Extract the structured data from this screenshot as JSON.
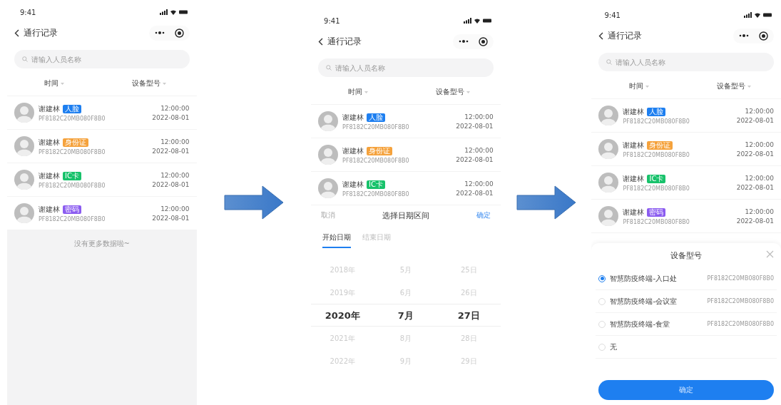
{
  "screens": [
    {
      "status_time": "9:41",
      "title": "通行记录",
      "search": {
        "placeholder": "请输入人员名称"
      },
      "filters": [
        "时间",
        "设备型号"
      ],
      "records": [
        {
          "name": "谢建林",
          "tag": {
            "label": "人脸",
            "color": "#1e7ff0"
          },
          "device": "PF8182C20MB080F8B0",
          "time": "12:00:00",
          "date": "2022-08-01"
        },
        {
          "name": "谢建林",
          "tag": {
            "label": "身份证",
            "color": "#f5a23c"
          },
          "device": "PF8182C20MB080F8B0",
          "time": "12:00:00",
          "date": "2022-08-01"
        },
        {
          "name": "谢建林",
          "tag": {
            "label": "IC卡",
            "color": "#18c26b"
          },
          "device": "PF8182C20MB080F8B0",
          "time": "12:00:00",
          "date": "2022-08-01"
        },
        {
          "name": "谢建林",
          "tag": {
            "label": "密码",
            "color": "#8b5cf0"
          },
          "device": "PF8182C20MB080F8B0",
          "time": "12:00:00",
          "date": "2022-08-01"
        }
      ],
      "footer": "没有更多数据啦~"
    },
    {
      "status_time": "9:41",
      "title": "通行记录",
      "search": {
        "placeholder": "请输入人员名称"
      },
      "filters": [
        "时间",
        "设备型号"
      ],
      "records": [
        {
          "name": "谢建林",
          "tag": {
            "label": "人脸",
            "color": "#1e7ff0"
          },
          "device": "PF8182C20MB080F8B0",
          "time": "12:00:00",
          "date": "2022-08-01"
        },
        {
          "name": "谢建林",
          "tag": {
            "label": "身份证",
            "color": "#f5a23c"
          },
          "device": "PF8182C20MB080F8B0",
          "time": "12:00:00",
          "date": "2022-08-01"
        },
        {
          "name": "谢建林",
          "tag": {
            "label": "IC卡",
            "color": "#18c26b"
          },
          "device": "PF8182C20MB080F8B0",
          "time": "12:00:00",
          "date": "2022-08-01"
        }
      ],
      "date_picker": {
        "cancel": "取消",
        "title": "选择日期区间",
        "confirm": "确定",
        "tabs": [
          {
            "label": "开始日期",
            "selected": true
          },
          {
            "label": "结束日期",
            "selected": false
          }
        ],
        "columns": [
          [
            {
              "label": "2018年",
              "selected": false
            },
            {
              "label": "2019年",
              "selected": false
            },
            {
              "label": "2020年",
              "selected": true
            },
            {
              "label": "2021年",
              "selected": false
            },
            {
              "label": "2022年",
              "selected": false
            }
          ],
          [
            {
              "label": "5月",
              "selected": false
            },
            {
              "label": "6月",
              "selected": false
            },
            {
              "label": "7月",
              "selected": true
            },
            {
              "label": "8月",
              "selected": false
            },
            {
              "label": "9月",
              "selected": false
            }
          ],
          [
            {
              "label": "25日",
              "selected": false
            },
            {
              "label": "26日",
              "selected": false
            },
            {
              "label": "27日",
              "selected": true
            },
            {
              "label": "28日",
              "selected": false
            },
            {
              "label": "29日",
              "selected": false
            }
          ]
        ]
      }
    },
    {
      "status_time": "9:41",
      "title": "通行记录",
      "search": {
        "placeholder": "请输入人员名称"
      },
      "filters": [
        "时间",
        "设备型号"
      ],
      "records": [
        {
          "name": "谢建林",
          "tag": {
            "label": "人脸",
            "color": "#1e7ff0"
          },
          "device": "PF8182C20MB080F8B0",
          "time": "12:00:00",
          "date": "2022-08-01"
        },
        {
          "name": "谢建林",
          "tag": {
            "label": "身份证",
            "color": "#f5a23c"
          },
          "device": "PF8182C20MB080F8B0",
          "time": "12:00:00",
          "date": "2022-08-01"
        },
        {
          "name": "谢建林",
          "tag": {
            "label": "IC卡",
            "color": "#18c26b"
          },
          "device": "PF8182C20MB080F8B0",
          "time": "12:00:00",
          "date": "2022-08-01"
        },
        {
          "name": "谢建林",
          "tag": {
            "label": "密码",
            "color": "#8b5cf0"
          },
          "device": "PF8182C20MB080F8B0",
          "time": "12:00:00",
          "date": "2022-08-01"
        }
      ],
      "device_sheet": {
        "title": "设备型号",
        "confirm": "确定",
        "options": [
          {
            "label": "智慧防疫终端-入口处",
            "code": "PF8182C20MB080F8B0",
            "selected": true
          },
          {
            "label": "智慧防疫终端-会议室",
            "code": "PF8182C20MB080F8B0",
            "selected": false
          },
          {
            "label": "智慧防疫终端-食堂",
            "code": "PF8182C20MB080F8B0",
            "selected": false
          },
          {
            "label": "无",
            "selected": false
          }
        ]
      }
    }
  ]
}
